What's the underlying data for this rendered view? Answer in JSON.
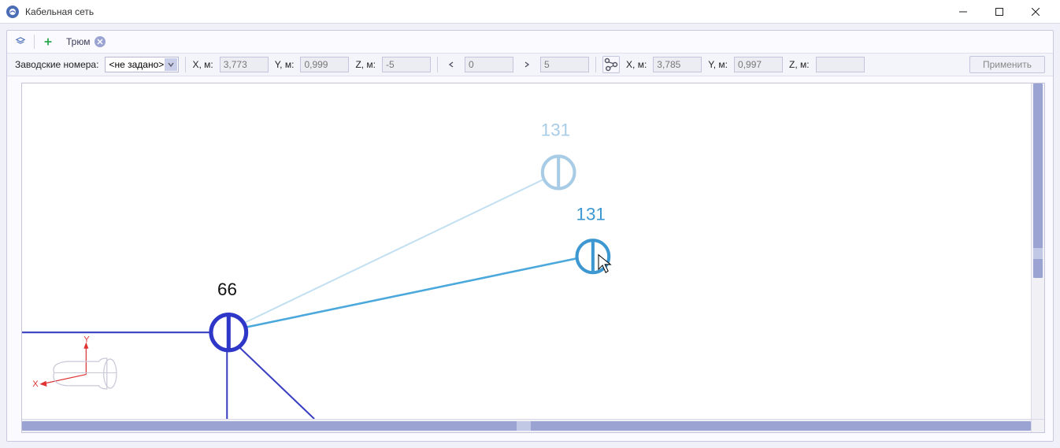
{
  "title": "Кабельная сеть",
  "tabs": {
    "main_tab": "Трюм"
  },
  "toolbar": {
    "serial_label": "Заводские номера:",
    "serial_value": "<не задано>",
    "x_label": "X, м:",
    "y_label": "Y, м:",
    "z_label": "Z, м:",
    "x_val": "3,773",
    "y_val": "0,999",
    "z_val": "-5",
    "range_lo": "0",
    "range_hi": "5",
    "x2_val": "3,785",
    "y2_val": "0,997",
    "z2_val": "",
    "apply": "Применить"
  },
  "canvas": {
    "node66": "66",
    "node131": "131",
    "node131ghost": "131",
    "axis_x": "X",
    "axis_y": "Y"
  }
}
